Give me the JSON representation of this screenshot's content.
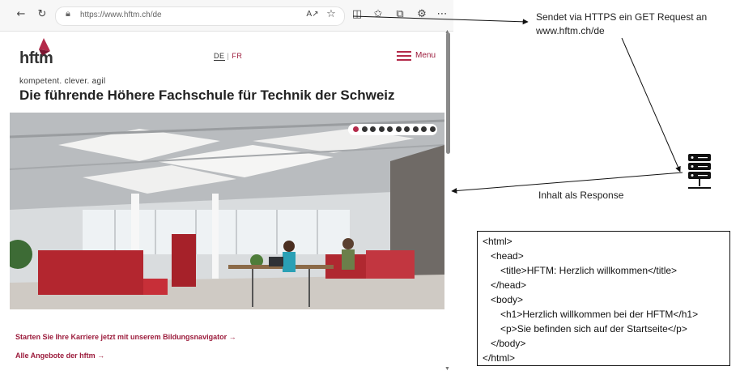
{
  "browser": {
    "url": "https://www.hftm.ch/de",
    "icons": [
      "back-icon",
      "reload-icon",
      "lock-icon",
      "read-aloud-icon",
      "favorite-star-icon",
      "split-screen-icon",
      "favorites-icon",
      "collections-icon",
      "extensions-icon",
      "more-icon"
    ]
  },
  "site": {
    "logo_text": "hftm",
    "lang_de": "DE",
    "lang_sep": "|",
    "lang_fr": "FR",
    "menu_label": "Menu",
    "tagline": "kompetent. clever. agil",
    "headline": "Die führende Höhere Fachschule für Technik der Schweiz",
    "cta_primary": "Starten Sie Ihre Karriere jetzt mit unserem Bildungsnavigator →",
    "cta_secondary": "Alle Angebote der hftm →",
    "carousel_dots": 10,
    "carousel_active": 0,
    "accent_color": "#9c1c3c"
  },
  "annotations": {
    "request_line1": "Sendet via HTTPS ein GET Request an",
    "request_line2": "www.hftm.ch/de",
    "response_label": "Inhalt als Response",
    "server_icon": "server-icon"
  },
  "code": {
    "lines": [
      "<html>",
      "<head>",
      "<title>HFTM: Herzlich willkommen</title>",
      "</head>",
      "<body>",
      "<h1>Herzlich willkommen bei der HFTM</h1>",
      "<p>Sie befinden sich auf der Startseite</p>",
      "</body>",
      "</html>"
    ]
  }
}
